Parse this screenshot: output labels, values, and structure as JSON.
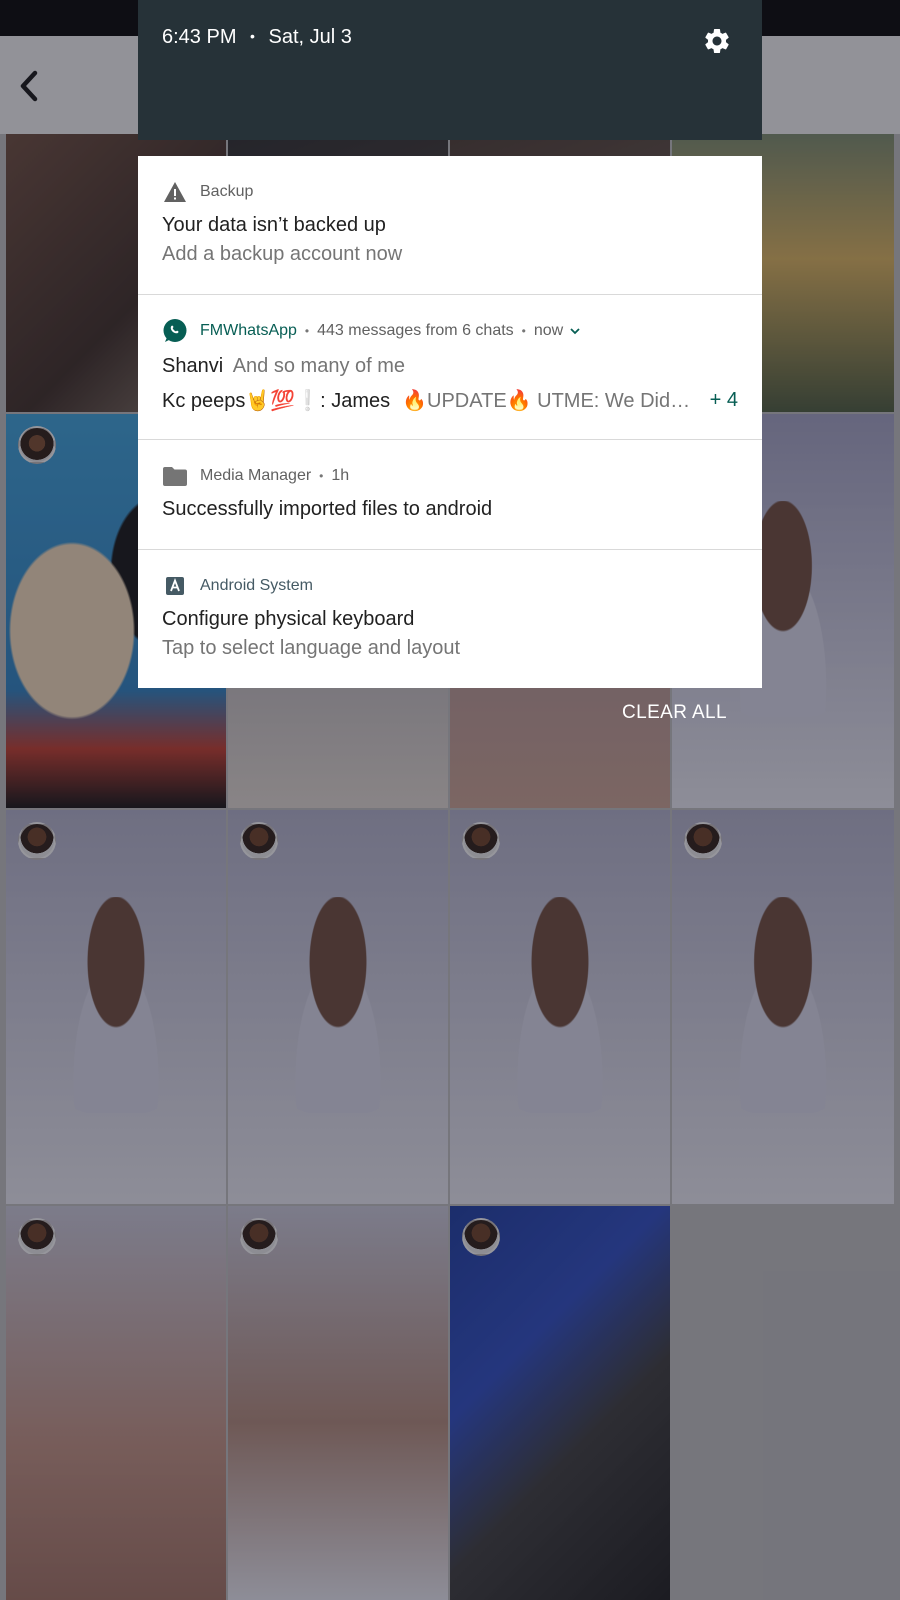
{
  "status_time": "6:43 PM",
  "status_date": "Sat, Jul 3",
  "notifications": {
    "backup": {
      "app": "Backup",
      "title": "Your data isn’t backed up",
      "text": "Add a backup account now"
    },
    "whatsapp": {
      "app": "FMWhatsApp",
      "summary": "443 messages from 6 chats",
      "time": "now",
      "line1_sender": "Shanvi",
      "line1_text": "And so many of me",
      "line2_left": "Kc peeps🤘💯❕: James",
      "line2_right": "🔥UPDATE🔥 UTME: We Did…",
      "more": "+ 4"
    },
    "media": {
      "app": "Media Manager",
      "time": "1h",
      "title": "Successfully imported files to android"
    },
    "android": {
      "app": "Android System",
      "title": "Configure physical keyboard",
      "text": "Tap to select language and layout"
    }
  },
  "clear_all": "CLEAR ALL",
  "colors": {
    "shade_header": "#263238",
    "whatsapp_accent": "#075e54",
    "android_accent": "#455a64"
  },
  "icons": [
    "back-arrow-icon",
    "settings-gear-icon",
    "warning-icon",
    "whatsapp-icon",
    "folder-icon",
    "android-a-icon",
    "chevron-down-icon"
  ]
}
